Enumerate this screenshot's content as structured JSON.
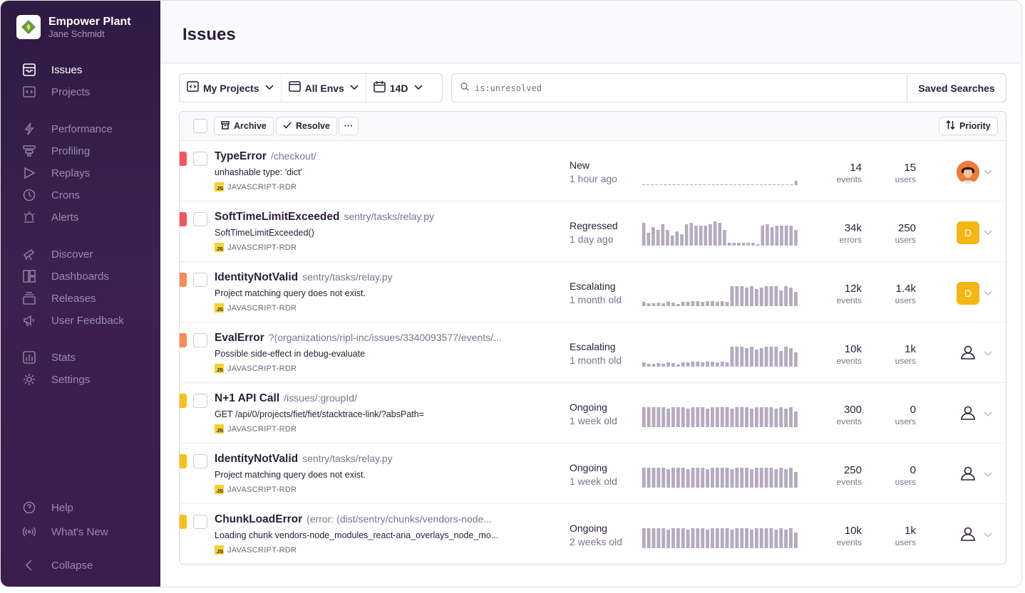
{
  "org": {
    "name": "Empower Plant",
    "user": "Jane Schmidt"
  },
  "sidebar": {
    "items": [
      {
        "label": "Issues",
        "icon": "inbox-icon",
        "active": true
      },
      {
        "label": "Projects",
        "icon": "code-window-icon"
      },
      {
        "label": "Performance",
        "icon": "lightning-icon"
      },
      {
        "label": "Profiling",
        "icon": "funnel-icon"
      },
      {
        "label": "Replays",
        "icon": "play-icon"
      },
      {
        "label": "Crons",
        "icon": "clock-icon"
      },
      {
        "label": "Alerts",
        "icon": "siren-icon"
      },
      {
        "label": "Discover",
        "icon": "telescope-icon"
      },
      {
        "label": "Dashboards",
        "icon": "dashboard-icon"
      },
      {
        "label": "Releases",
        "icon": "package-icon"
      },
      {
        "label": "User Feedback",
        "icon": "megaphone-icon"
      },
      {
        "label": "Stats",
        "icon": "bar-chart-icon"
      },
      {
        "label": "Settings",
        "icon": "gear-icon"
      }
    ],
    "footer": [
      {
        "label": "Help",
        "icon": "question-icon"
      },
      {
        "label": "What's New",
        "icon": "broadcast-icon"
      },
      {
        "label": "Collapse",
        "icon": "chevron-left-icon"
      }
    ]
  },
  "header": {
    "title": "Issues"
  },
  "filters": {
    "projects": "My Projects",
    "envs": "All Envs",
    "period": "14D"
  },
  "search": {
    "placeholder": "is:unresolved",
    "saved_label": "Saved Searches"
  },
  "toolbar": {
    "archive": "Archive",
    "resolve": "Resolve",
    "more": "···",
    "sort": "Priority"
  },
  "colors": {
    "high": "#f5555f",
    "medium": "#fb8a58",
    "low": "#f9c019",
    "avatar": "#f2b712"
  },
  "issues": [
    {
      "type": "TypeError",
      "location": "/checkout/",
      "message": "unhashable type: 'dict'",
      "project": "JAVASCRIPT-RDR",
      "status": "New",
      "age": "1 hour ago",
      "count": "14",
      "count_unit": "events",
      "users": "15",
      "users_unit": "users",
      "assignee": "photo",
      "priority": "high",
      "trend": [
        1,
        1,
        1,
        1,
        1,
        1,
        1,
        1,
        1,
        1,
        1,
        1,
        1,
        1,
        1,
        1,
        1,
        1,
        1,
        1,
        1,
        1,
        1,
        1,
        1,
        1,
        1,
        1,
        1,
        1,
        1,
        1,
        1,
        1,
        1,
        6
      ]
    },
    {
      "type": "SoftTimeLimitExceeded",
      "location": "sentry/tasks/relay.py",
      "message": "SoftTimeLimitExceeded()",
      "project": "JAVASCRIPT-RDR",
      "status": "Regressed",
      "age": "1 day ago",
      "count": "34k",
      "count_unit": "errors",
      "users": "250",
      "users_unit": "users",
      "assignee": "D",
      "priority": "high",
      "trend": [
        32,
        18,
        26,
        22,
        30,
        22,
        14,
        20,
        16,
        30,
        32,
        28,
        28,
        28,
        30,
        34,
        32,
        22,
        4,
        4,
        4,
        4,
        4,
        4,
        2,
        28,
        30,
        26,
        28,
        28,
        28,
        28,
        22
      ]
    },
    {
      "type": "IdentityNotValid",
      "location": "sentry/tasks/relay.py",
      "message": "Project matching query does not exist.",
      "project": "JAVASCRIPT-RDR",
      "status": "Escalating",
      "age": "1 month old",
      "count": "12k",
      "count_unit": "events",
      "users": "1.4k",
      "users_unit": "users",
      "assignee": "D",
      "priority": "medium",
      "trend": [
        6,
        4,
        4,
        5,
        4,
        6,
        5,
        3,
        6,
        6,
        7,
        7,
        6,
        7,
        7,
        6,
        7,
        6,
        28,
        28,
        28,
        26,
        28,
        24,
        26,
        28,
        28,
        28,
        22,
        28,
        26,
        20
      ]
    },
    {
      "type": "EvalError",
      "location": "?(organizations/ripl-inc/issues/3340093577/events/...",
      "message": "Possible side-effect in debug-evaluate",
      "project": "JAVASCRIPT-RDR",
      "status": "Escalating",
      "age": "1 month old",
      "count": "10k",
      "count_unit": "events",
      "users": "1k",
      "users_unit": "users",
      "assignee": "none",
      "priority": "medium",
      "trend": [
        6,
        4,
        4,
        5,
        4,
        6,
        5,
        3,
        6,
        6,
        7,
        7,
        6,
        7,
        7,
        6,
        7,
        6,
        28,
        28,
        28,
        26,
        28,
        24,
        26,
        28,
        28,
        28,
        22,
        28,
        26,
        20
      ]
    },
    {
      "type": "N+1 API Call",
      "location": "/issues/:groupId/",
      "message": "GET /api/0/projects/fiet/fiet/stacktrace-link/?absPath=",
      "project": "JAVASCRIPT-RDR",
      "status": "Ongoing",
      "age": "1 week old",
      "count": "300",
      "count_unit": "events",
      "users": "0",
      "users_unit": "users",
      "assignee": "none",
      "priority": "low",
      "trend": [
        28,
        28,
        28,
        28,
        28,
        26,
        28,
        28,
        28,
        26,
        28,
        28,
        28,
        26,
        28,
        28,
        28,
        28,
        26,
        28,
        28,
        28,
        26,
        28,
        28,
        28,
        28,
        26,
        28,
        26,
        28,
        22
      ]
    },
    {
      "type": "IdentityNotValid",
      "location": "sentry/tasks/relay.py",
      "message": "Project matching query does not exist.",
      "project": "JAVASCRIPT-RDR",
      "status": "Ongoing",
      "age": "1 week old",
      "count": "250",
      "count_unit": "events",
      "users": "0",
      "users_unit": "users",
      "assignee": "none",
      "priority": "low",
      "trend": [
        28,
        28,
        28,
        28,
        28,
        26,
        28,
        28,
        28,
        26,
        28,
        28,
        28,
        26,
        28,
        28,
        28,
        28,
        26,
        28,
        28,
        28,
        26,
        28,
        28,
        28,
        28,
        26,
        28,
        26,
        28,
        22
      ]
    },
    {
      "type": "ChunkLoadError",
      "location": "(error: (dist/sentry/chunks/vendors-node...",
      "message": "Loading chunk vendors-node_modules_react-aria_overlays_node_mo...",
      "project": "JAVASCRIPT-RDR",
      "status": "Ongoing",
      "age": "2 weeks old",
      "count": "10k",
      "count_unit": "events",
      "users": "1k",
      "users_unit": "users",
      "assignee": "none",
      "priority": "low",
      "trend": [
        28,
        28,
        28,
        28,
        28,
        26,
        28,
        28,
        28,
        26,
        28,
        28,
        28,
        26,
        28,
        28,
        28,
        28,
        26,
        28,
        28,
        28,
        26,
        28,
        28,
        28,
        28,
        26,
        28,
        26,
        28,
        22
      ]
    }
  ]
}
